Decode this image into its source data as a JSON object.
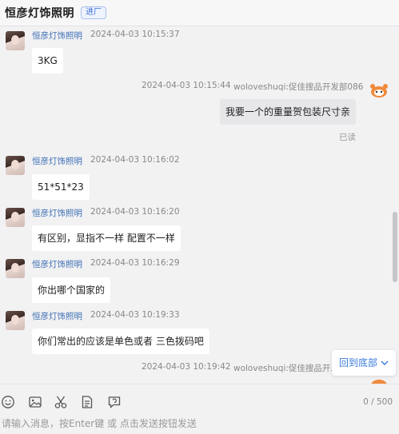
{
  "header": {
    "shop_name": "恒彦灯饰照明",
    "badge": "进厂"
  },
  "messages": [
    {
      "sender": "恒彦灯饰照明",
      "time": "2024-04-03 10:15:37",
      "text": "3KG"
    },
    {
      "sender": "恒彦灯饰照明",
      "time": "2024-04-03 10:16:02",
      "text": "51*51*23"
    },
    {
      "sender": "恒彦灯饰照明",
      "time": "2024-04-03 10:16:20",
      "text": "有区别，显指不一样 配置不一样"
    },
    {
      "sender": "恒彦灯饰照明",
      "time": "2024-04-03 10:16:29",
      "text": "你出哪个国家的"
    },
    {
      "sender": "恒彦灯饰照明",
      "time": "2024-04-03 10:19:33",
      "text": "你们常出的应该是单色或者 三色拨码吧"
    }
  ],
  "my_messages": [
    {
      "time": "2024-04-03 10:15:44",
      "sender": "woloveshuqi:促佳搜品开发部086",
      "text": "我要一个的重量贺包装尺寸亲",
      "status": "已读"
    },
    {
      "time": "2024-04-03 10:19:42",
      "sender": "woloveshuqi:促佳搜品开发部"
    }
  ],
  "jump_bottom": {
    "label": "回到底部"
  },
  "toolbar": {
    "icons": [
      "emoji-icon",
      "image-icon",
      "scissors-icon",
      "document-icon",
      "history-icon"
    ],
    "char_count": "0 / 500",
    "placeholder": "请输入消息，按Enter键 或 点击发送按钮发送"
  },
  "colors": {
    "sender": "#3d6fb5",
    "link": "#3a7bdc",
    "background": "#f2f2f3",
    "bubble": "#ffffff",
    "my_bubble": "#e7e7ea"
  }
}
